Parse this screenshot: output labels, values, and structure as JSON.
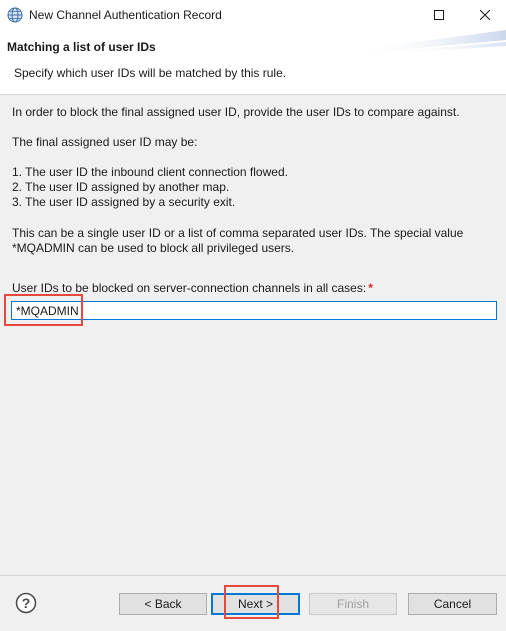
{
  "window": {
    "title": "New Channel Authentication Record",
    "app_icon": "globe-icon",
    "maximize_icon": "maximize-icon",
    "close_icon": "close-icon"
  },
  "banner": {
    "title": "Matching a list of user IDs",
    "description": "Specify which user IDs will be matched by this rule."
  },
  "body": {
    "intro": "In order to block the final assigned user ID, provide the user IDs to compare against.",
    "may_be": "The final assigned user ID may be:",
    "options": [
      "1. The user ID the inbound client connection flowed.",
      "2. The user ID assigned by another map.",
      "3. The user ID assigned by a security exit."
    ],
    "note_line1": "This can be a single user ID or a list of comma separated user IDs. The special value",
    "note_line2": "*MQADMIN can be used to block all privileged users.",
    "field_label": "User IDs to be blocked on server-connection channels in all cases:",
    "required_marker": "*",
    "field_value": "*MQADMIN"
  },
  "footer": {
    "help_icon": "help-icon",
    "back_label": "< Back",
    "next_label": "Next >",
    "finish_label": "Finish",
    "cancel_label": "Cancel"
  },
  "colors": {
    "highlight": "#e8493f",
    "focus": "#0078d7",
    "required": "#d9261c"
  }
}
